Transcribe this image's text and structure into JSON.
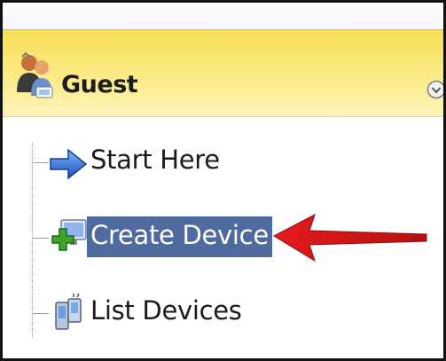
{
  "header": {
    "title": "Guest",
    "icon": "guest-users-icon",
    "collapse_icon": "chevron-down-circle-icon"
  },
  "nav": {
    "items": [
      {
        "label": "Start Here",
        "icon": "arrow-right-icon",
        "selected": false
      },
      {
        "label": "Create Device",
        "icon": "add-device-icon",
        "selected": true
      },
      {
        "label": "List Devices",
        "icon": "devices-icon",
        "selected": false
      }
    ]
  },
  "colors": {
    "header_bg": "#f7df55",
    "selection_bg": "#4f6a9f",
    "annotation_arrow": "#e02020"
  },
  "annotation": {
    "type": "arrow",
    "points_to": "Create Device"
  }
}
